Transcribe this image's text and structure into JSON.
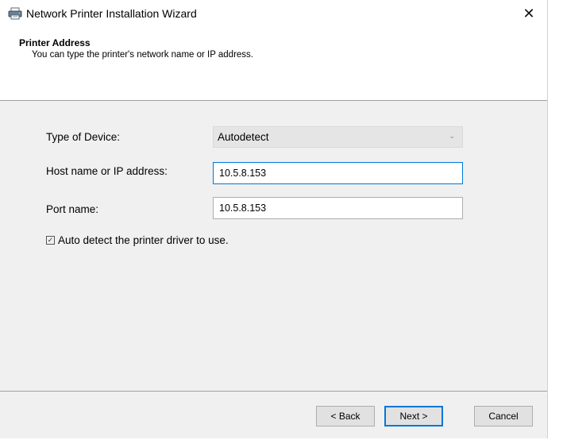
{
  "window": {
    "title": "Network Printer Installation Wizard",
    "close_glyph": "✕",
    "icon": "printer-icon"
  },
  "header": {
    "title": "Printer Address",
    "subtitle": "You can type the printer's network name or IP address."
  },
  "form": {
    "type_label": "Type of Device:",
    "type_value": "Autodetect",
    "type_arrow": "⌄",
    "host_label": "Host name or IP address:",
    "host_value": "10.5.8.153",
    "port_label": "Port name:",
    "port_value": "10.5.8.153",
    "auto_detect_label": "Auto detect the printer driver to use.",
    "auto_detect_checked": true,
    "check_glyph": "✓"
  },
  "buttons": {
    "back": "< Back",
    "next": "Next >",
    "cancel": "Cancel"
  },
  "colors": {
    "accent": "#0078d7",
    "panel": "#f0f0f0"
  }
}
